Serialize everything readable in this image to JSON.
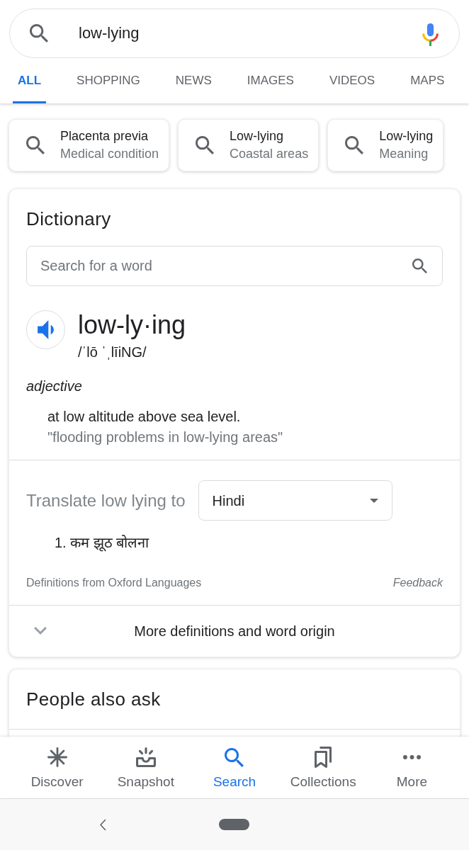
{
  "search_bar": {
    "query": "low-lying"
  },
  "tabs": [
    {
      "label": "ALL",
      "selected": true
    },
    {
      "label": "SHOPPING",
      "selected": false
    },
    {
      "label": "NEWS",
      "selected": false
    },
    {
      "label": "IMAGES",
      "selected": false
    },
    {
      "label": "VIDEOS",
      "selected": false
    },
    {
      "label": "MAPS",
      "selected": false
    }
  ],
  "related_searches": [
    {
      "title": "Placenta previa",
      "subtitle": "Medical condition"
    },
    {
      "title": "Low-lying",
      "subtitle": "Coastal areas"
    },
    {
      "title": "Low-lying",
      "subtitle": "Meaning"
    }
  ],
  "dictionary": {
    "title": "Dictionary",
    "search": {
      "placeholder": "Search for a word"
    },
    "word": "low-ly·ing",
    "phonetic": "/ˈlō ˈˌlīiNG/",
    "part_of_speech": "adjective",
    "definition": "at low altitude above sea level.",
    "example": "\"flooding problems in low-lying areas\"",
    "translate": {
      "label": "Translate low lying to",
      "language": "Hindi",
      "results": [
        "1. कम झूठ बोलना"
      ]
    },
    "source": "Definitions from Oxford Languages",
    "feedback": "Feedback",
    "more": {
      "label": "More definitions and word origin",
      "expanded": false
    }
  },
  "people_also_ask": {
    "title": "People also ask"
  },
  "bottom_nav": [
    {
      "label": "Discover",
      "selected": false
    },
    {
      "label": "Snapshot",
      "selected": false
    },
    {
      "label": "Search",
      "selected": true
    },
    {
      "label": "Collections",
      "selected": false
    },
    {
      "label": "More",
      "selected": false
    }
  ]
}
